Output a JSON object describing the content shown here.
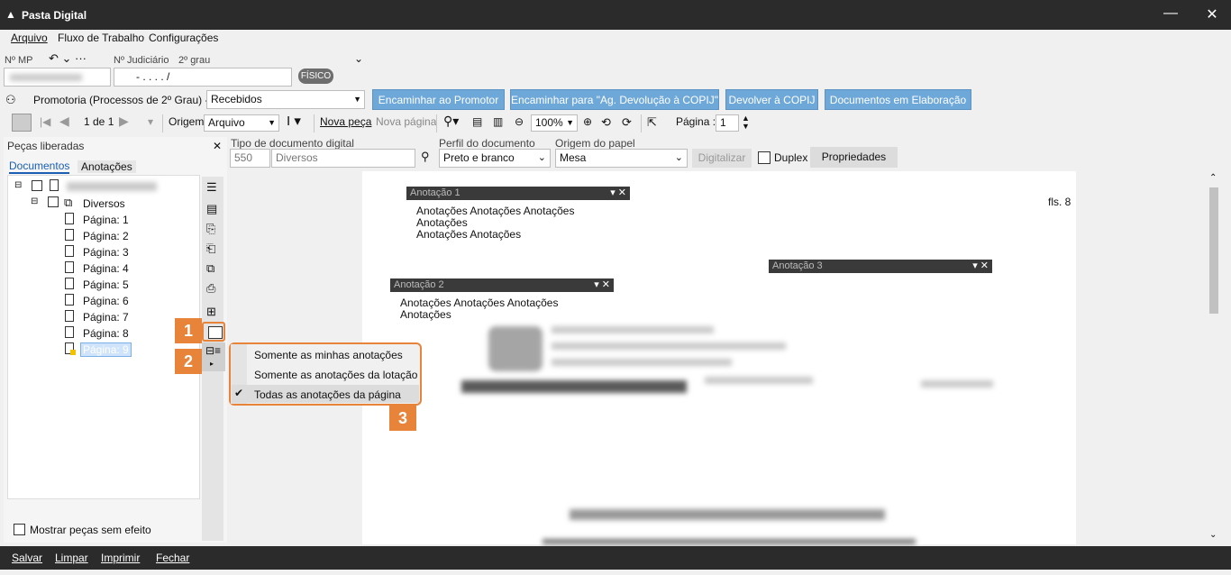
{
  "window": {
    "title": "Pasta Digital"
  },
  "menu": {
    "arquivo": "Arquivo",
    "fluxo": "Fluxo de Trabalho",
    "config": "Configurações"
  },
  "header": {
    "nmp_label": "Nº MP",
    "judicial_label": "Nº Judiciário",
    "grau": "2º grau",
    "judicial_value": "- .  . . .  /",
    "fisico": "FÍSICO"
  },
  "queue": {
    "label": "Promotoria (Processos de 2º Grau) - Fila",
    "value": "Recebidos",
    "buttons": [
      "Encaminhar ao Promotor",
      "Encaminhar para \"Ag. Devolução à COPIJ\"",
      "Devolver à COPIJ",
      "Documentos em Elaboração"
    ]
  },
  "toolbar": {
    "page_nav": "1 de 1",
    "origem_label": "Origem",
    "origem_value": "Arquivo",
    "nova_peca": "Nova peça",
    "nova_pagina": "Nova página",
    "zoom": "100%",
    "pagina_label": "Página :",
    "pagina_value": "1"
  },
  "doc_fields": {
    "tipo_label": "Tipo de documento digital",
    "tipo_code": "550",
    "tipo_value": "Diversos",
    "perfil_label": "Perfil do documento",
    "perfil_value": "Preto e branco",
    "origem_papel_label": "Origem do papel",
    "origem_papel_value": "Mesa",
    "digitalizar": "Digitalizar",
    "duplex": "Duplex",
    "propriedades": "Propriedades"
  },
  "leftpanel": {
    "title": "Peças liberadas",
    "tabs": [
      "Documentos",
      "Anotações"
    ],
    "folder": "Diversos",
    "pages": [
      "Página: 1",
      "Página: 2",
      "Página: 3",
      "Página: 4",
      "Página: 5",
      "Página: 6",
      "Página: 7",
      "Página: 8",
      "Página: 9"
    ],
    "mostrar": "Mostrar peças sem efeito"
  },
  "document": {
    "fls": "fls. 8",
    "annotations": [
      {
        "title": "Anotação 1",
        "text1": "Anotações Anotações Anotações Anotações",
        "text2": "Anotações Anotações"
      },
      {
        "title": "Anotação 2",
        "text1": "Anotações Anotações Anotações Anotações"
      },
      {
        "title": "Anotação 3"
      }
    ]
  },
  "context_menu": {
    "items": [
      "Somente as minhas anotações",
      "Somente as anotações da lotação",
      "Todas as anotações da página"
    ],
    "checked_index": 2
  },
  "badges": [
    "1",
    "2",
    "3"
  ],
  "bottom": {
    "salvar": "Salvar",
    "limpar": "Limpar",
    "imprimir": "Imprimir",
    "fechar": "Fechar"
  },
  "colors": {
    "accent": "#e8833a",
    "button_blue": "#6ea8d8",
    "titlebar": "#2b2b2b"
  }
}
